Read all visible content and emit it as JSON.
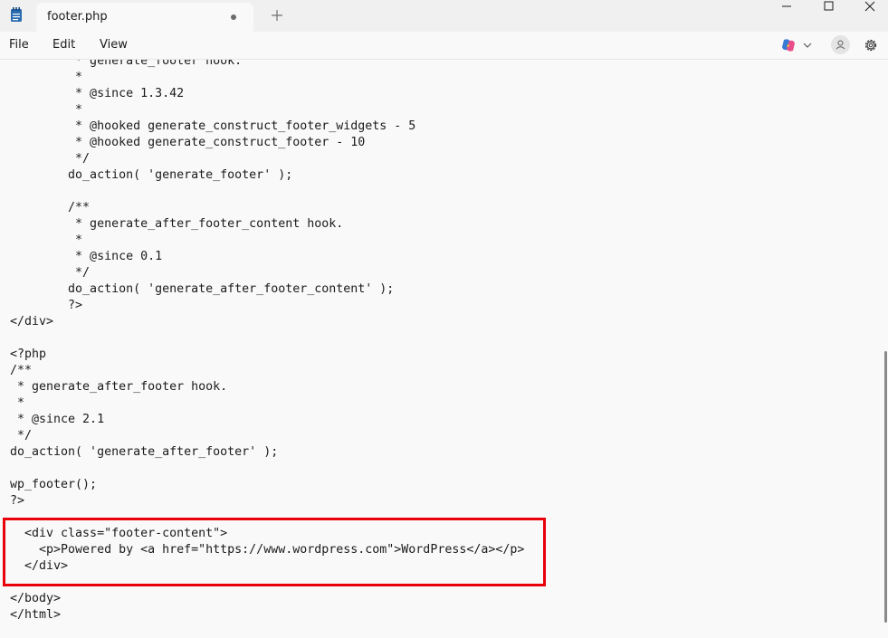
{
  "tab": {
    "title": "footer.php"
  },
  "menu": {
    "file": "File",
    "edit": "Edit",
    "view": "View"
  },
  "colors": {
    "highlight": "#e8000b",
    "app_icon": "#2b6cb0"
  },
  "icons": {
    "app": "notepad-icon",
    "new_tab": "plus-icon",
    "unsaved": "dot-icon",
    "minimize": "minimize-icon",
    "maximize": "maximize-icon",
    "close": "close-icon",
    "copilot": "copilot-icon",
    "account": "account-icon",
    "settings": "gear-icon"
  },
  "editor": {
    "lines": [
      "         * generate_footer hook.",
      "         *",
      "         * @since 1.3.42",
      "         *",
      "         * @hooked generate_construct_footer_widgets - 5",
      "         * @hooked generate_construct_footer - 10",
      "         */",
      "        do_action( 'generate_footer' );",
      "",
      "        /**",
      "         * generate_after_footer_content hook.",
      "         *",
      "         * @since 0.1",
      "         */",
      "        do_action( 'generate_after_footer_content' );",
      "        ?>",
      "</div>",
      "",
      "<?php",
      "/**",
      " * generate_after_footer hook.",
      " *",
      " * @since 2.1",
      " */",
      "do_action( 'generate_after_footer' );",
      "",
      "wp_footer();",
      "?>",
      "",
      "  <div class=\"footer-content\">",
      "    <p>Powered by <a href=\"https://www.wordpress.com\">WordPress</a></p>",
      "  </div>",
      "",
      "</body>",
      "</html>"
    ]
  }
}
